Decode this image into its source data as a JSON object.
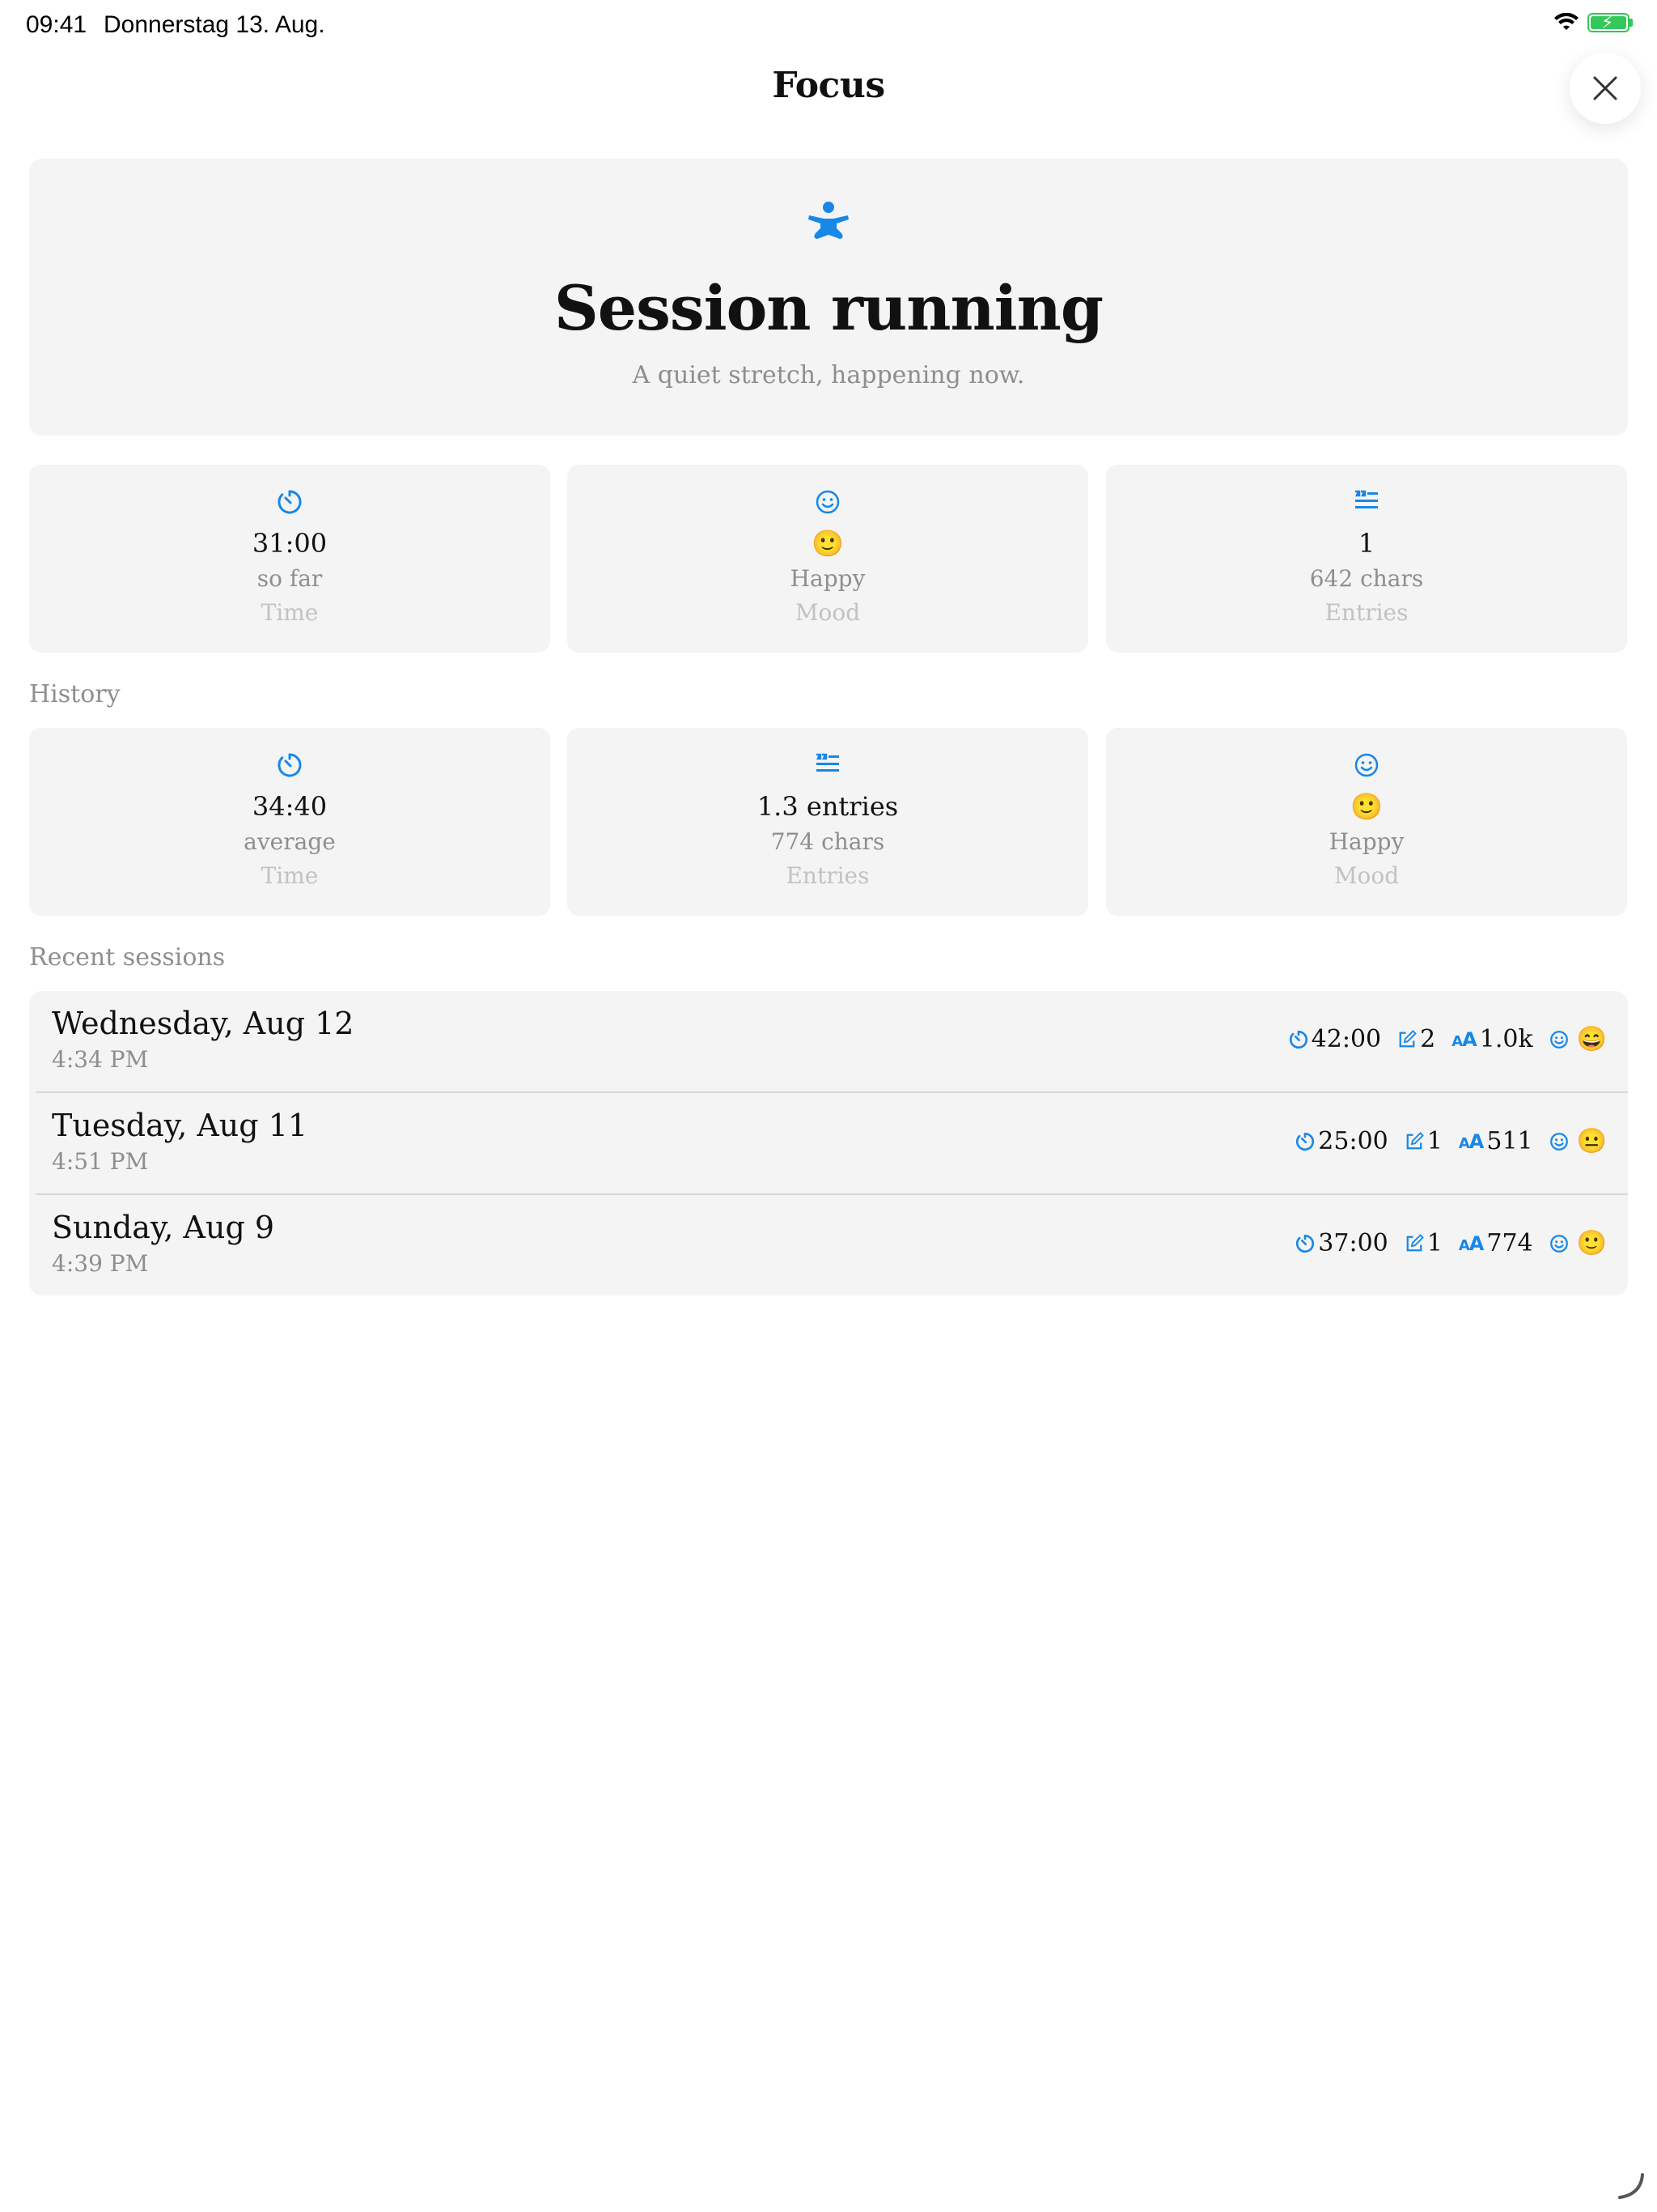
{
  "status": {
    "time": "09:41",
    "date": "Donnerstag 13. Aug."
  },
  "header": {
    "title": "Focus"
  },
  "hero": {
    "title": "Session running",
    "subtitle": "A quiet stretch, happening now."
  },
  "current": [
    {
      "icon": "timer-icon",
      "value": "31:00",
      "detail": "so far",
      "label": "Time"
    },
    {
      "icon": "smiley-icon",
      "value": "🙂",
      "detail": "Happy",
      "label": "Mood"
    },
    {
      "icon": "text-quote-icon",
      "value": "1",
      "detail": "642 chars",
      "label": "Entries"
    }
  ],
  "history": {
    "label": "History",
    "cards": [
      {
        "icon": "timer-icon",
        "value": "34:40",
        "detail": "average",
        "label": "Time"
      },
      {
        "icon": "text-quote-icon",
        "value": "1.3 entries",
        "detail": "774 chars",
        "label": "Entries"
      },
      {
        "icon": "smiley-icon",
        "value": "🙂",
        "detail": "Happy",
        "label": "Mood"
      }
    ]
  },
  "recent": {
    "label": "Recent sessions",
    "rows": [
      {
        "date": "Wednesday, Aug 12",
        "time": "4:34 PM",
        "duration": "42:00",
        "entries": "2",
        "chars": "1.0k",
        "mood": "😄"
      },
      {
        "date": "Tuesday, Aug 11",
        "time": "4:51 PM",
        "duration": "25:00",
        "entries": "1",
        "chars": "511",
        "mood": "😐"
      },
      {
        "date": "Sunday, Aug 9",
        "time": "4:39 PM",
        "duration": "37:00",
        "entries": "1",
        "chars": "774",
        "mood": "🙂"
      }
    ]
  },
  "colors": {
    "accent": "#1787e8",
    "card": "#f4f4f4",
    "secondary_text": "#8e8e8e",
    "tertiary_text": "#c2c2c2"
  }
}
